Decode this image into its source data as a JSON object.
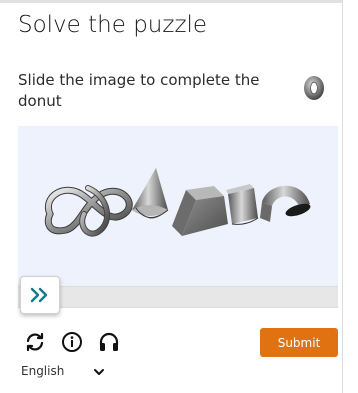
{
  "title": "Solve the puzzle",
  "instruction": "Slide the image to complete the donut",
  "target_shape": "donut-icon",
  "puzzle": {
    "shapes": [
      "knot-icon",
      "cone-icon",
      "cube-icon",
      "cylinder-icon",
      "half-torus-icon"
    ],
    "slider_position": 0
  },
  "slider": {
    "handle_icon": "double-chevron-right-icon"
  },
  "toolbar": {
    "refresh_icon": "refresh-icon",
    "info_icon": "info-icon",
    "audio_icon": "headphones-icon",
    "submit_label": "Submit"
  },
  "language": {
    "selected": "English"
  },
  "colors": {
    "accent": "#e07212",
    "handle_icon": "#127a8a",
    "puzzle_bg": "#edf2fc"
  }
}
